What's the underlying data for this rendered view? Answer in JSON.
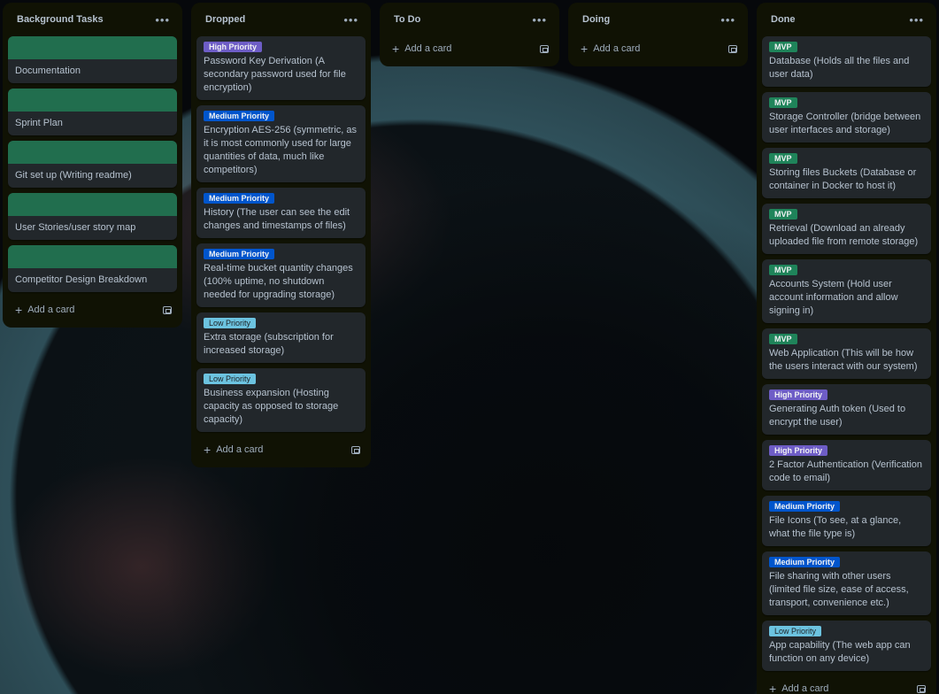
{
  "lists": [
    {
      "title": "Background Tasks",
      "add_label": "Add a card",
      "cards": [
        {
          "title": "Documentation",
          "cover": true
        },
        {
          "title": "Sprint Plan",
          "cover": true
        },
        {
          "title": "Git set up (Writing readme)",
          "cover": true
        },
        {
          "title": "User Stories/user story map",
          "cover": true
        },
        {
          "title": "Competitor Design Breakdown",
          "cover": true
        }
      ]
    },
    {
      "title": "Dropped",
      "add_label": "Add a card",
      "cards": [
        {
          "label": "High Priority",
          "label_type": "high",
          "title": "Password Key Derivation (A secondary password used for file encryption)"
        },
        {
          "label": "Medium Priority",
          "label_type": "medium",
          "title": "Encryption AES-256 (symmetric, as it is most commonly used for large quantities of data, much like competitors)"
        },
        {
          "label": "Medium Priority",
          "label_type": "medium",
          "title": "History (The user can see the edit changes and timestamps of files)"
        },
        {
          "label": "Medium Priority",
          "label_type": "medium",
          "title": "Real-time bucket quantity changes (100% uptime, no shutdown needed for upgrading storage)"
        },
        {
          "label": "Low Priority",
          "label_type": "low",
          "title": "Extra storage (subscription for increased storage)"
        },
        {
          "label": "Low Priority",
          "label_type": "low",
          "title": "Business expansion (Hosting capacity as opposed to storage capacity)"
        }
      ]
    },
    {
      "title": "To Do",
      "add_label": "Add a card",
      "cards": []
    },
    {
      "title": "Doing",
      "add_label": "Add a card",
      "cards": []
    },
    {
      "title": "Done",
      "add_label": "Add a card",
      "cards": [
        {
          "label": "MVP",
          "label_type": "mvp",
          "title": "Database (Holds all the files and user data)"
        },
        {
          "label": "MVP",
          "label_type": "mvp",
          "title": "Storage Controller (bridge between user interfaces and storage)"
        },
        {
          "label": "MVP",
          "label_type": "mvp",
          "title": "Storing files Buckets (Database or container in Docker to host it)"
        },
        {
          "label": "MVP",
          "label_type": "mvp",
          "title": "Retrieval (Download an already uploaded file from remote storage)"
        },
        {
          "label": "MVP",
          "label_type": "mvp",
          "title": "Accounts System (Hold user account information and allow signing in)"
        },
        {
          "label": "MVP",
          "label_type": "mvp",
          "title": "Web Application (This will be how the users interact with our system)"
        },
        {
          "label": "High Priority",
          "label_type": "high",
          "title": "Generating Auth token (Used to encrypt the user)"
        },
        {
          "label": "High Priority",
          "label_type": "high",
          "title": "2 Factor Authentication (Verification code to email)"
        },
        {
          "label": "Medium Priority",
          "label_type": "medium",
          "title": "File Icons (To see, at a glance, what the file type is)"
        },
        {
          "label": "Medium Priority",
          "label_type": "medium",
          "title": "File sharing with other users (limited file size, ease of access, transport, convenience etc.)"
        },
        {
          "label": "Low Priority",
          "label_type": "low",
          "title": "App capability (The web app can function on any device)"
        }
      ]
    }
  ]
}
